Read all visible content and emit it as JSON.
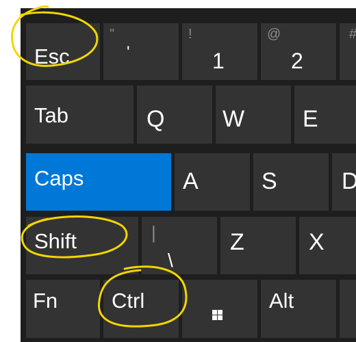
{
  "keyboard": {
    "row1": {
      "esc": "Esc",
      "quote_secondary": "\"",
      "quote_primary": "'",
      "one_secondary": "!",
      "one_primary": "1",
      "two_secondary": "@",
      "two_primary": "2",
      "three_secondary": "#"
    },
    "row2": {
      "tab": "Tab",
      "q": "Q",
      "w": "W",
      "e": "E"
    },
    "row3": {
      "caps": "Caps",
      "a": "A",
      "s": "S",
      "d": "D"
    },
    "row4": {
      "shift": "Shift",
      "bslash_secondary": "|",
      "bslash_primary": "\\",
      "z": "Z",
      "x": "X"
    },
    "row5": {
      "fn": "Fn",
      "ctrl": "Ctrl",
      "win_icon": "windows-logo-icon",
      "alt": "Alt"
    }
  },
  "colors": {
    "keyboard_bg": "#1e1e1e",
    "key_bg": "#333333",
    "active_key": "#0078d7",
    "annotation": "#f2d600",
    "secondary_text": "#8a8a8a"
  },
  "annotations": [
    "esc-circle",
    "shift-circle",
    "ctrl-circle"
  ]
}
